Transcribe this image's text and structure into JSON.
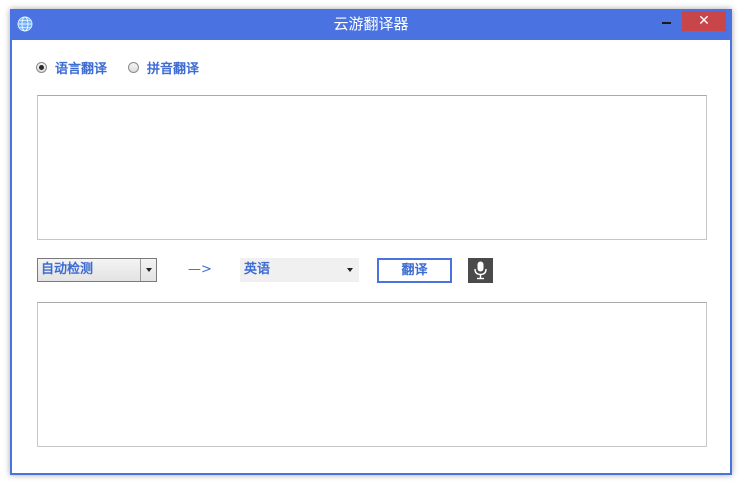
{
  "window": {
    "title": "云游翻译器",
    "close_glyph": "✕",
    "accent_color": "#4a72e0",
    "close_color": "#c8464a"
  },
  "mode": {
    "options": [
      {
        "label": "语言翻译",
        "checked": true
      },
      {
        "label": "拼音翻译",
        "checked": false
      }
    ]
  },
  "input": {
    "value": ""
  },
  "controls": {
    "source_language": "自动检测",
    "arrow": "—>",
    "target_language": "英语",
    "translate_label": "翻译",
    "mic_icon": "microphone-icon"
  },
  "output": {
    "value": ""
  }
}
